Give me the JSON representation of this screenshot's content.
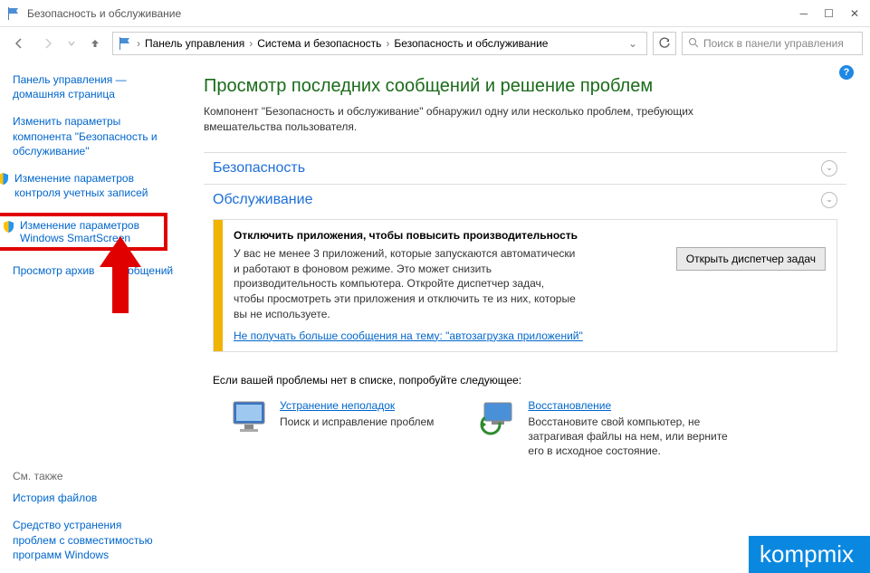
{
  "window": {
    "title": "Безопасность и обслуживание"
  },
  "breadcrumb": {
    "item0": "Панель управления",
    "item1": "Система и безопасность",
    "item2": "Безопасность и обслуживание"
  },
  "search": {
    "placeholder": "Поиск в панели управления"
  },
  "sidebar": {
    "home": "Панель управления — домашняя страница",
    "change_params": "Изменить параметры компонента \"Безопасность и обслуживание\"",
    "uac": "Изменение параметров контроля учетных записей",
    "smartscreen": "Изменение параметров Windows SmartScreen",
    "archive": "Просмотр архив         ообщений",
    "seealso_hd": "См. также",
    "seealso_1": "История файлов",
    "seealso_2": "Средство устранения проблем с совместимостью программ Windows"
  },
  "main": {
    "title": "Просмотр последних сообщений и решение проблем",
    "subtitle": "Компонент \"Безопасность и обслуживание\" обнаружил одну или несколько проблем, требующих вмешательства пользователя.",
    "sec_security": "Безопасность",
    "sec_maintenance": "Обслуживание",
    "notice_title": "Отключить приложения, чтобы повысить производительность",
    "notice_text": "У вас не менее 3 приложений, которые запускаются автоматически и работают в фоновом режиме. Это может снизить производительность компьютера. Откройте диспетчер задач, чтобы просмотреть эти приложения и отключить те из них, которые вы не используете.",
    "notice_link": "Не получать больше сообщения на тему: \"автозагрузка приложений\"",
    "notice_button": "Открыть диспетчер задач",
    "try_following": "Если вашей проблемы нет в списке, попробуйте следующее:",
    "tile1_title": "Устранение неполадок",
    "tile1_desc": "Поиск и исправление проблем",
    "tile2_title": "Восстановление",
    "tile2_desc": "Восстановите свой компьютер, не затрагивая файлы на нем, или верните его в исходное состояние."
  },
  "watermark": "kompmix"
}
